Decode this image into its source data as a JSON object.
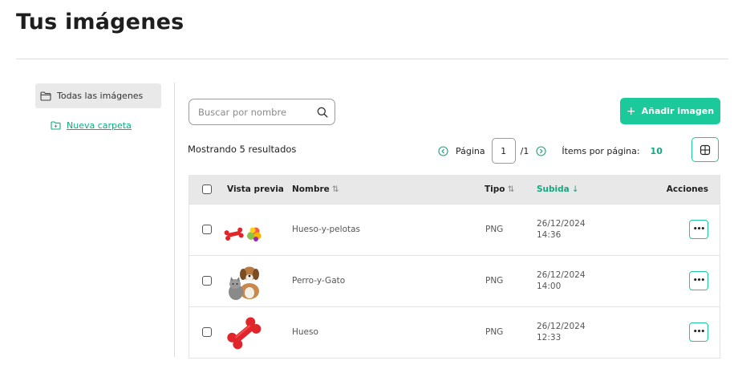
{
  "header": {
    "title": "Tus imágenes"
  },
  "sidebar": {
    "all_images_label": "Todas las imágenes",
    "new_folder_label": "Nueva carpeta"
  },
  "toolbar": {
    "search_placeholder": "Buscar por nombre",
    "add_image_label": "Añadir imagen",
    "add_icon": "+"
  },
  "pagination": {
    "results_text": "Mostrando 5 resultados",
    "page_label": "Página",
    "current_page": "1",
    "total_pages": "/1",
    "items_per_page_label": "Ítems por página:",
    "items_per_page": "10"
  },
  "table": {
    "columns": {
      "preview": "Vista previa",
      "name": "Nombre",
      "type": "Tipo",
      "uploaded": "Subida",
      "actions": "Acciones"
    },
    "sort_icons": {
      "name": "⇅",
      "type": "⇅",
      "uploaded": "↓"
    },
    "rows": [
      {
        "name": "Hueso-y-pelotas",
        "type": "PNG",
        "date": "26/12/2024",
        "time": "14:36",
        "thumb": "bone-and-balls"
      },
      {
        "name": "Perro-y-Gato",
        "type": "PNG",
        "date": "26/12/2024",
        "time": "14:00",
        "thumb": "dog-and-cat"
      },
      {
        "name": "Hueso",
        "type": "PNG",
        "date": "26/12/2024",
        "time": "12:33",
        "thumb": "red-bone"
      }
    ],
    "actions_glyph": "•••"
  },
  "colors": {
    "accent": "#1cc99a",
    "accent_text": "#12a981",
    "header_bg": "#e8e8e8",
    "sidebar_active_bg": "#e9e9e9"
  },
  "icons": [
    "folder-icon",
    "folder-plus-icon",
    "search-icon",
    "plus-icon",
    "chevron-left-circle-icon",
    "chevron-right-circle-icon",
    "grid-view-icon",
    "more-icon"
  ]
}
